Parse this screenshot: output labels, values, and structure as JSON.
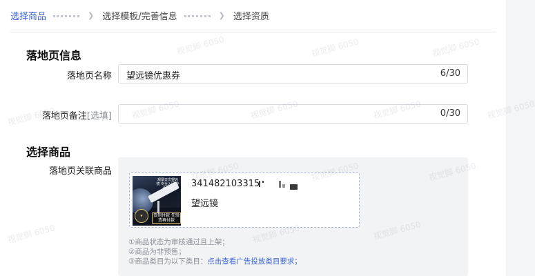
{
  "steps": [
    {
      "label": "选择商品",
      "active": true
    },
    {
      "label": "选择模板/完善信息",
      "active": false
    },
    {
      "label": "选择资质",
      "active": false
    }
  ],
  "sections": {
    "landing_info_title": "落地页信息",
    "select_product_title": "选择商品"
  },
  "form": {
    "name_label": "落地页名称",
    "name_value": "望远镜优惠券",
    "name_count": "6/30",
    "remark_label": "落地页备注",
    "remark_optional": "[选填]",
    "remark_value": "",
    "remark_count": "0/30",
    "related_label": "落地页关联商品"
  },
  "product": {
    "id": "341482103315",
    "name": "望远镜",
    "thumb_caption": "观景天文望远镜 专业入门 专业设计",
    "thumb_badge": "货到付款 先验货再付款"
  },
  "notes": {
    "line1": "①商品状态为审核通过且上架；",
    "line2": "②商品为非预售；",
    "line3_prefix": "③商品类目为以下类目：",
    "line3_link": "点击查看广告投放类目要求；"
  },
  "watermark": "视觉脚 6050",
  "colors": {
    "accent": "#3b63d6",
    "page_bg": "#f4f5f7",
    "product_bg": "#f2f3f5"
  }
}
